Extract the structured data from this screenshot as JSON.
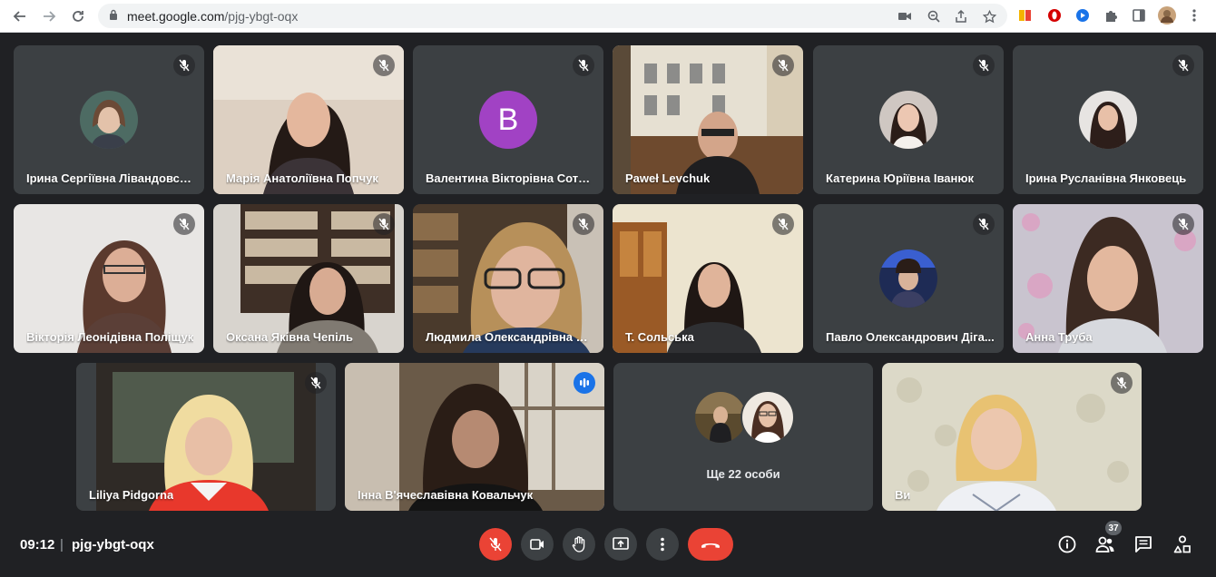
{
  "browser": {
    "url_host": "meet.google.com",
    "url_path": "/pjg-ybgt-oqx"
  },
  "participants": [
    {
      "name": "Ірина Сергіївна Лівандовська",
      "muted": true
    },
    {
      "name": "Марія Анатоліївна Попчук",
      "muted": true
    },
    {
      "name": "Валентина Вікторівна Сотні...",
      "muted": true,
      "avatar_letter": "B"
    },
    {
      "name": "Paweł Levchuk",
      "muted": true
    },
    {
      "name": "Катерина Юріївна Іванюк",
      "muted": true
    },
    {
      "name": "Ірина Русланівна Янковець",
      "muted": true
    },
    {
      "name": "Вікторія Леонідівна Поліщук",
      "muted": true
    },
    {
      "name": "Оксана Яківна Чепіль",
      "muted": true
    },
    {
      "name": "Людмила Олександрівна Тк...",
      "muted": true
    },
    {
      "name": "Т. Сольська",
      "muted": true
    },
    {
      "name": "Павло Олександрович Діга...",
      "muted": true
    },
    {
      "name": "Анна Труба",
      "muted": true
    },
    {
      "name": "Liliya Pidgorna",
      "muted": true
    },
    {
      "name": "Інна В'ячеславівна Ковальчук",
      "muted": false,
      "speaking": true
    },
    {
      "name": "Ви",
      "muted": true
    }
  ],
  "more_tile": {
    "label": "Ще 22 особи"
  },
  "bottom_bar": {
    "time": "09:12",
    "separator": "|",
    "meeting_code": "pjg-ybgt-oqx",
    "participant_count": "37"
  },
  "colors": {
    "accent": "#1a73e8",
    "danger": "#ea4335",
    "tile": "#3c4043",
    "background": "#202124",
    "letter_avatar": "#a142c4"
  }
}
